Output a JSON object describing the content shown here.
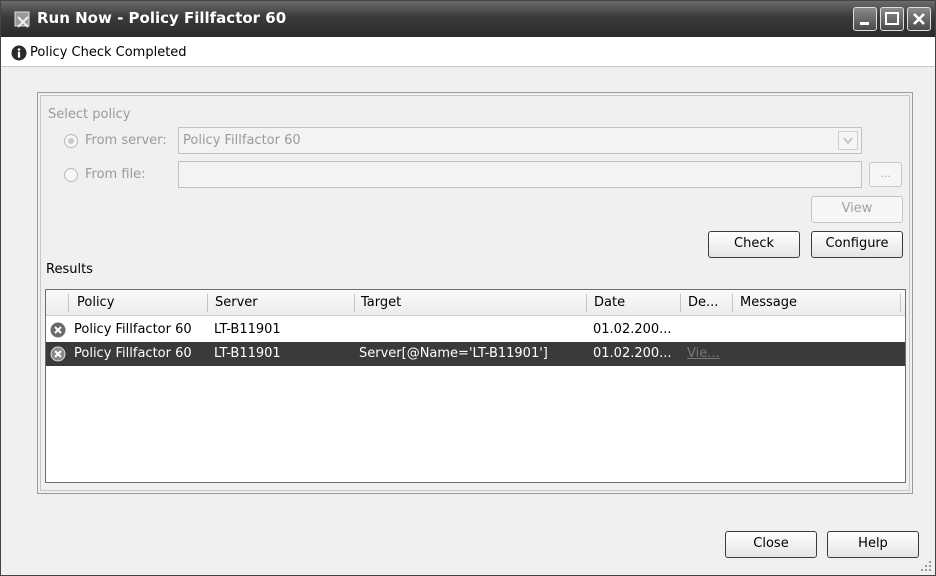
{
  "window": {
    "title": "Run Now - Policy Fillfactor 60",
    "status": "Policy Check Completed"
  },
  "select_policy": {
    "group_label": "Select policy",
    "from_server_label": "From server:",
    "from_server_value": "Policy Fillfactor 60",
    "from_file_label": "From file:",
    "from_file_value": "",
    "browse_label": "...",
    "view_label": "View"
  },
  "actions": {
    "check_label": "Check",
    "configure_label": "Configure"
  },
  "results": {
    "label": "Results",
    "columns": [
      "Policy",
      "Server",
      "Target",
      "Date",
      "De...",
      "Message"
    ],
    "rows": [
      {
        "policy": "Policy Fillfactor 60",
        "server": "LT-B11901",
        "target": "",
        "date": "01.02.200...",
        "details": "",
        "message": ""
      },
      {
        "policy": "Policy Fillfactor 60",
        "server": "LT-B11901",
        "target": "Server[@Name='LT-B11901']",
        "date": "01.02.200...",
        "details": "Vie...",
        "message": ""
      }
    ]
  },
  "footer": {
    "close_label": "Close",
    "help_label": "Help"
  },
  "icons": {
    "title": "policy-app-icon",
    "status": "info-icon",
    "row": "error-x-icon"
  },
  "colors": {
    "selected_row": "#3a3a3a",
    "titlebar": "#3a3a3a"
  }
}
